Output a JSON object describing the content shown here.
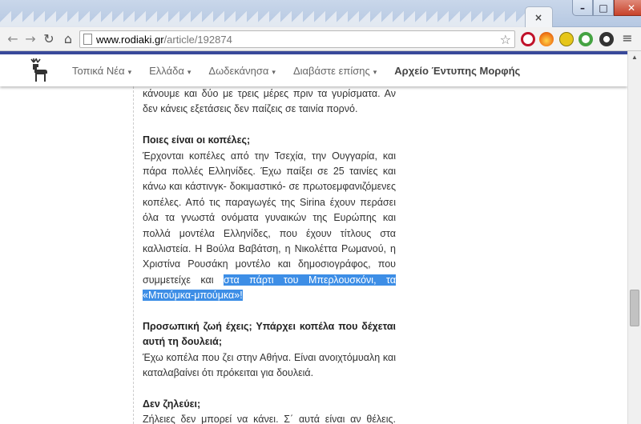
{
  "window": {
    "tab_close": "×",
    "min": "–",
    "max": "□",
    "close": "✕"
  },
  "toolbar": {
    "back": "←",
    "forward": "→",
    "reload": "↻",
    "home": "⌂",
    "url_host": "www.rodiaki.gr",
    "url_path": "/article/192874",
    "star": "☆",
    "menu": "≡",
    "extensions": [
      {
        "name": "record-extension-icon",
        "color": "#c0122a"
      },
      {
        "name": "fire-extension-icon",
        "color": "#f07a18"
      },
      {
        "name": "h-extension-icon",
        "color": "#e6c61a"
      },
      {
        "name": "q-extension-icon",
        "color": "#45a342"
      },
      {
        "name": "gear-icon",
        "color": "#333333"
      }
    ]
  },
  "site_nav": {
    "items": [
      {
        "label": "Τοπικά Νέα",
        "caret": "▾"
      },
      {
        "label": "Ελλάδα",
        "caret": "▾"
      },
      {
        "label": "Δωδεκάνησα",
        "caret": "▾"
      },
      {
        "label": "Διαβάστε επίσης",
        "caret": "▾"
      },
      {
        "label": "Αρχείο Έντυπης Μορφής",
        "caret": ""
      }
    ]
  },
  "article": {
    "p0": "κάνουμε και δύο με τρεις μέρες πριν τα γυρίσματα. Αν δεν κάνεις εξετάσεις δεν παίζεις σε ταινία πορνό.",
    "q1": "Ποιες είναι οι κοπέλες;",
    "a1": "Έρχονται κοπέλες από την Τσεχία, την Ουγγαρία, και πάρα πολλές Ελληνίδες. Έχω παίξει σε 25 ταινίες και κάνω και κάστινγκ- δοκιμαστικό- σε πρωτοεμφανιζόμενες κοπέλες. Από τις παραγωγές της Sirina έχουν περάσει όλα τα γνωστά ονόματα γυναικών της Ευρώπης και πολλά μοντέλα Ελληνίδες, που έχουν τίτλους στα καλλιστεία. Η Βούλα Βαβάτση, η Νικολέττα Ρωμανού, η Χριστίνα Ρουσάκη μοντέλο και δημοσιογράφος, που συμμετείχε και",
    "a1_highlight": "στα πάρτι του Μπερλουσκόνι, τα «Μπούμκα-μπούμκα»!",
    "q2": "Προσωπική ζωή έχεις; Υπάρχει κοπέλα που δέχεται αυτή τη δουλειά;",
    "a2": "Έχω κοπέλα που ζει στην Αθήνα. Είναι ανοιχτόμυαλη και καταλαβαίνει ότι πρόκειται για δουλειά.",
    "q3": "Δεν ζηλεύει;",
    "a3": "Ζήλειες δεν μπορεί να κάνει. Σ΄ αυτά είναι αν θέλεις. Αλλιώς ο δρόμος είναι ανοιχτός."
  },
  "colors": {
    "nav_border": "#39499a",
    "selection": "#3d8ee6"
  }
}
